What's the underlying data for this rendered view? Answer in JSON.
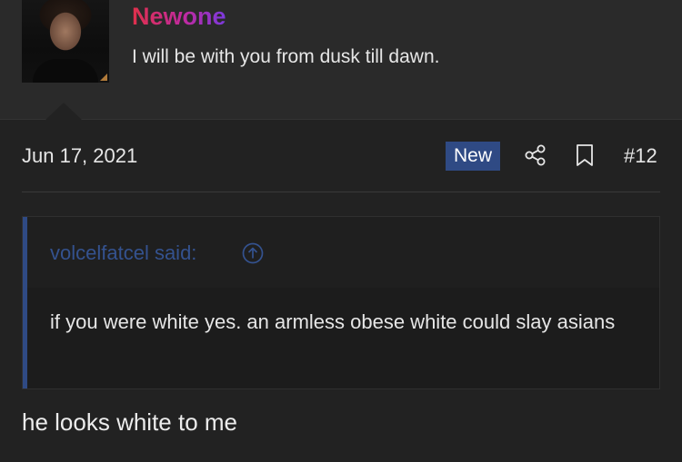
{
  "author": {
    "username": "Newone",
    "title": "I will be with you from dusk till dawn."
  },
  "post": {
    "date": "Jun 17, 2021",
    "badge": "New",
    "number": "#12",
    "icons": {
      "share": "share-icon",
      "bookmark": "bookmark-icon",
      "quote_up": "arrow-up-circle-icon"
    }
  },
  "quote": {
    "author_said": "volcelfatcel said:",
    "body": "if you were white yes. an armless obese white could slay asians"
  },
  "reply": {
    "text": "he looks white to me"
  },
  "colors": {
    "background": "#222222",
    "header_bg": "#2a2a2a",
    "accent_blue": "#2f4a84",
    "username_gradient": [
      "#e0304a",
      "#c02aa0",
      "#7a3ae0"
    ],
    "text": "#e6e6e6"
  }
}
